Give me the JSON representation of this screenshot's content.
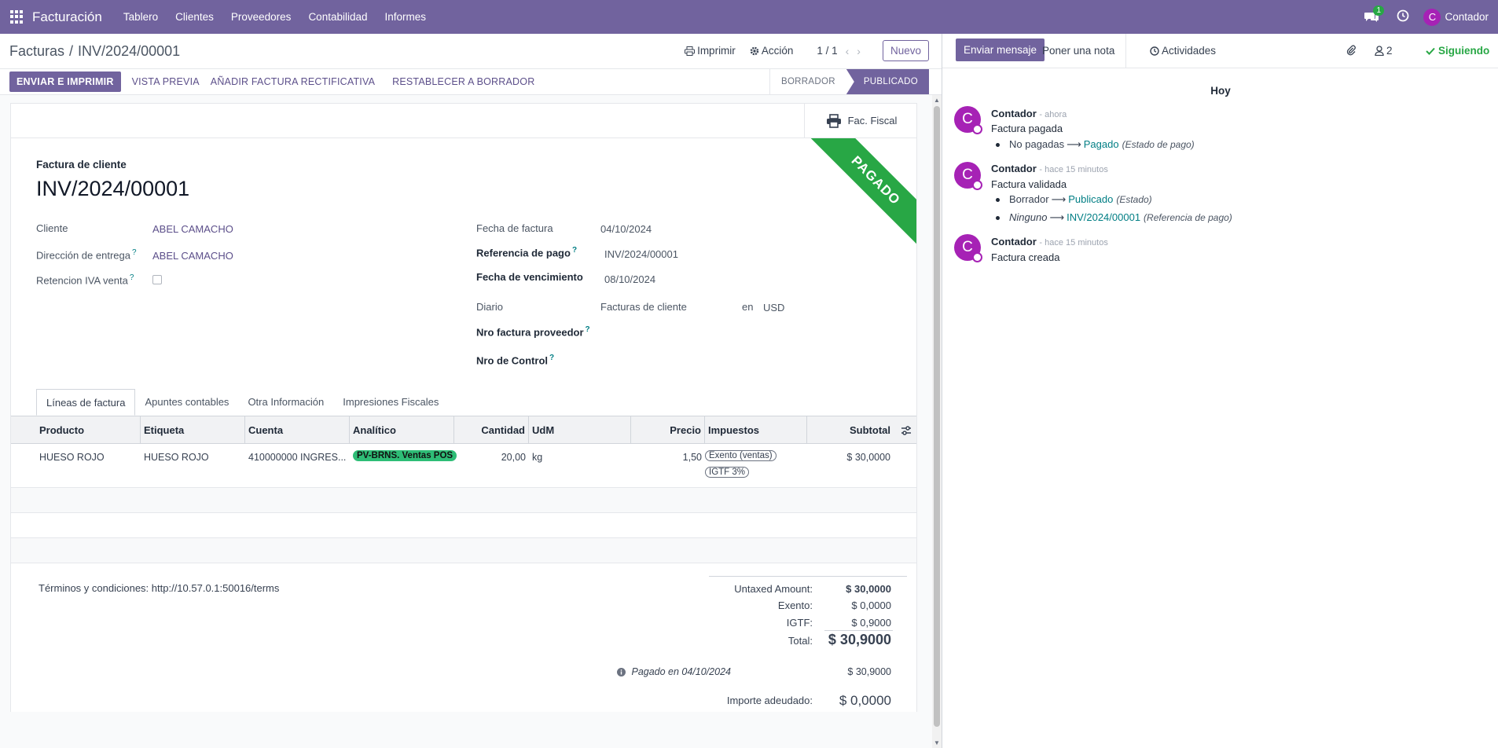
{
  "navbar": {
    "app_name": "Facturación",
    "menu": [
      "Tablero",
      "Clientes",
      "Proveedores",
      "Contabilidad",
      "Informes"
    ],
    "chat_badge": "1",
    "user_initial": "C",
    "user_name": "Contador",
    "accent": "#71639e"
  },
  "control_panel": {
    "breadcrumb_parent": "Facturas",
    "breadcrumb_sep": "/",
    "breadcrumb_current": "INV/2024/00001",
    "print": "Imprimir",
    "action": "Acción",
    "pager": "1 / 1",
    "prev": "‹",
    "next": "›",
    "new": "Nuevo"
  },
  "status_bar": {
    "buttons": {
      "send_print": "ENVIAR E IMPRIMIR",
      "preview": "VISTA PREVIA",
      "credit_note": "AÑADIR FACTURA RECTIFICATIVA",
      "reset": "RESTABLECER A BORRADOR"
    },
    "states": {
      "draft": "BORRADOR",
      "posted": "PUBLICADO"
    }
  },
  "invoice": {
    "fiscal_button": "Fac. Fiscal",
    "ribbon": "PAGADO",
    "type": "Factura de cliente",
    "name": "INV/2024/00001",
    "fields": {
      "customer_label": "Cliente",
      "customer": "ABEL CAMACHO",
      "delivery_label": "Dirección de entrega",
      "delivery": "ABEL CAMACHO",
      "retention_label": "Retencion IVA venta",
      "invoice_date_label": "Fecha de factura",
      "invoice_date": "04/10/2024",
      "payment_ref_label": "Referencia de pago",
      "payment_ref": "INV/2024/00001",
      "due_date_label": "Fecha de vencimiento",
      "due_date": "08/10/2024",
      "journal_label": "Diario",
      "journal": "Facturas de cliente",
      "journal_in": "en",
      "currency": "USD",
      "supplier_inv_label": "Nro factura proveedor",
      "control_label": "Nro de Control",
      "help": "?"
    },
    "tabs": [
      "Líneas de factura",
      "Apuntes contables",
      "Otra Información",
      "Impresiones Fiscales"
    ],
    "columns": [
      "Producto",
      "Etiqueta",
      "Cuenta",
      "Analítico",
      "Cantidad",
      "UdM",
      "Precio",
      "Impuestos",
      "Subtotal"
    ],
    "lines": [
      {
        "product": "HUESO ROJO",
        "label": "HUESO ROJO",
        "account": "410000000 INGRES...",
        "analytic": "PV-BRNS. Ventas POS",
        "quantity": "20,00",
        "uom": "kg",
        "price": "1,50",
        "taxes": [
          "Exento (ventas)",
          "IGTF 3%"
        ],
        "subtotal": "$ 30,0000"
      }
    ],
    "terms": "Términos y condiciones: http://10.57.0.1:50016/terms",
    "totals": {
      "untaxed_label": "Untaxed Amount:",
      "untaxed": "$ 30,0000",
      "exento_label": "Exento:",
      "exento": "$ 0,0000",
      "igtf_label": "IGTF:",
      "igtf": "$ 0,9000",
      "total_label": "Total:",
      "total": "$ 30,9000",
      "paid_label": "Pagado en 04/10/2024",
      "paid": "$ 30,9000",
      "due_label": "Importe adeudado:",
      "due": "$ 0,0000"
    }
  },
  "chatter": {
    "send_message": "Enviar mensaje",
    "log_note": "Poner una nota",
    "activities": "Actividades",
    "followers_count": "2",
    "following": "Siguiendo",
    "date_separator": "Hoy",
    "messages": [
      {
        "initial": "C",
        "author": "Contador",
        "time": "- ahora",
        "body": "Factura pagada",
        "changes": [
          {
            "old": "No pagadas",
            "new": "Pagado",
            "field": "(Estado de pago)"
          }
        ]
      },
      {
        "initial": "C",
        "author": "Contador",
        "time": "- hace 15 minutos",
        "body": "Factura validada",
        "changes": [
          {
            "old": "Borrador",
            "new": "Publicado",
            "field": "(Estado)"
          },
          {
            "old": "Ninguno",
            "new": "INV/2024/00001",
            "field": "(Referencia de pago)"
          }
        ]
      },
      {
        "initial": "C",
        "author": "Contador",
        "time": "- hace 15 minutos",
        "body": "Factura creada",
        "changes": []
      }
    ]
  }
}
